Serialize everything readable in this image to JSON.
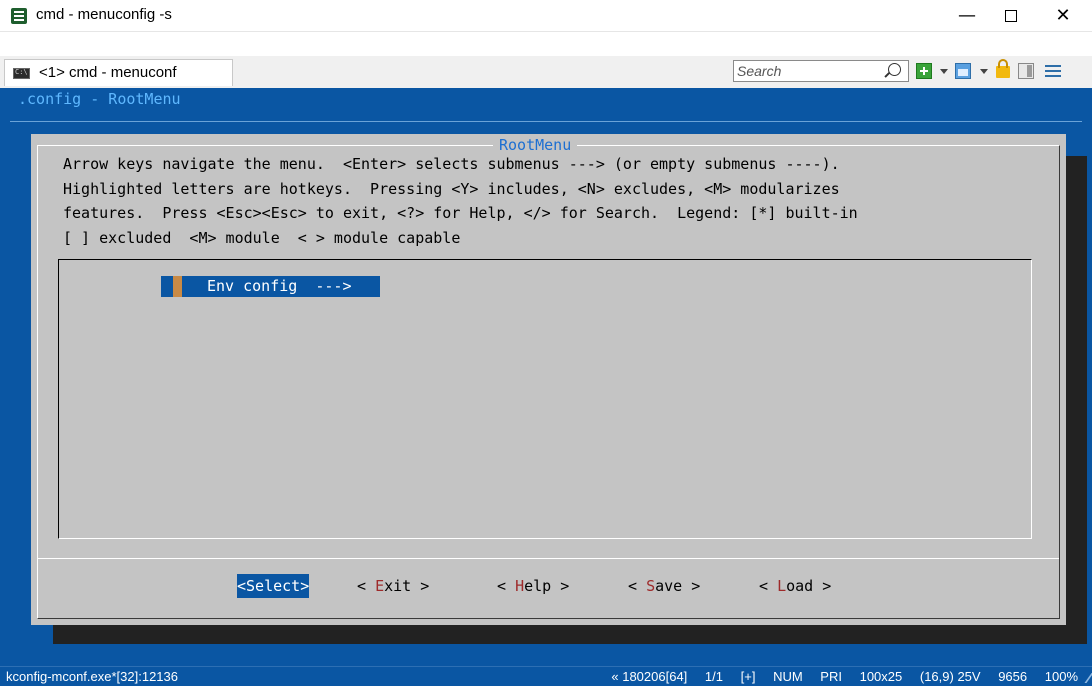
{
  "window": {
    "title": "cmd - menuconfig  -s",
    "minimize": "—",
    "close": "✕"
  },
  "tabbar": {
    "tab_label": "<1> cmd - menuconf",
    "search_placeholder": "Search"
  },
  "console": {
    "config_title": ".config - RootMenu",
    "dialog_title": "RootMenu",
    "help_lines": [
      "Arrow keys navigate the menu.  <Enter> selects submenus ---> (or empty submenus ----).",
      "Highlighted letters are hotkeys.  Pressing <Y> includes, <N> excludes, <M> modularizes",
      "features.  Press <Esc><Esc> to exit, <?> for Help, </> for Search.  Legend: [*] built-in",
      "[ ] excluded  <M> module  < > module capable"
    ],
    "menu_items": [
      {
        "label": "Env config  --->"
      }
    ],
    "buttons": {
      "select": "<Select>",
      "exit_pre": "< ",
      "exit_hot": "E",
      "exit_post": "xit >",
      "help_pre": "< ",
      "help_hot": "H",
      "help_post": "elp >",
      "save_pre": "< ",
      "save_hot": "S",
      "save_post": "ave >",
      "load_pre": "< ",
      "load_hot": "L",
      "load_post": "oad >"
    }
  },
  "statusbar": {
    "process": "kconfig-mconf.exe*[32]:12136",
    "pos": "« 180206[64]",
    "pages": "1/1",
    "plus": "[+]",
    "num": "NUM",
    "pri": "PRI",
    "size": "100x25",
    "coords": "(16,9) 25V",
    "mem": "9656",
    "zoom": "100%"
  },
  "colors": {
    "console_bg": "#0a56a3",
    "dialog_bg": "#c4c4c4",
    "dialog_title": "#1c6fd2",
    "hotkey": "#9e2a2a"
  }
}
